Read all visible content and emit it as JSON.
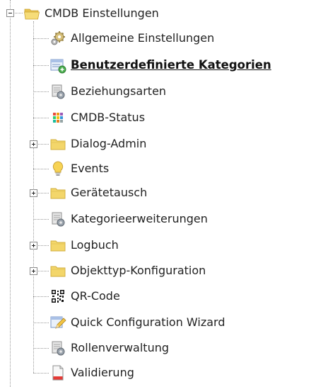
{
  "tree": {
    "root": {
      "label": "CMDB Einstellungen",
      "icon": "folder-open-icon",
      "expanded": true
    },
    "items": [
      {
        "label": "Allgemeine Einstellungen",
        "icon": "gear-cog-icon",
        "expandable": false
      },
      {
        "label": "Benutzerdefinierte Kategorien",
        "icon": "custom-category-icon",
        "expandable": false,
        "selected": true
      },
      {
        "label": "Beziehungsarten",
        "icon": "gear-document-icon",
        "expandable": false
      },
      {
        "label": "CMDB-Status",
        "icon": "color-grid-icon",
        "expandable": false
      },
      {
        "label": "Dialog-Admin",
        "icon": "folder-icon",
        "expandable": true
      },
      {
        "label": "Events",
        "icon": "lightbulb-icon",
        "expandable": false
      },
      {
        "label": "Gerätetausch",
        "icon": "folder-icon",
        "expandable": true
      },
      {
        "label": "Kategorieerweiterungen",
        "icon": "gear-document-icon",
        "expandable": false
      },
      {
        "label": "Logbuch",
        "icon": "folder-icon",
        "expandable": true
      },
      {
        "label": "Objekttyp-Konfiguration",
        "icon": "folder-icon",
        "expandable": true
      },
      {
        "label": "QR-Code",
        "icon": "qr-code-icon",
        "expandable": false
      },
      {
        "label": "Quick Configuration Wizard",
        "icon": "wizard-pencil-icon",
        "expandable": false
      },
      {
        "label": "Rollenverwaltung",
        "icon": "gear-document-icon",
        "expandable": false
      },
      {
        "label": "Validierung",
        "icon": "document-red-icon",
        "expandable": false
      }
    ]
  },
  "colors": {
    "folder": "#f3d66a",
    "folder_dark": "#d9b43a",
    "connector": "#9a9a9a",
    "text": "#222222"
  }
}
